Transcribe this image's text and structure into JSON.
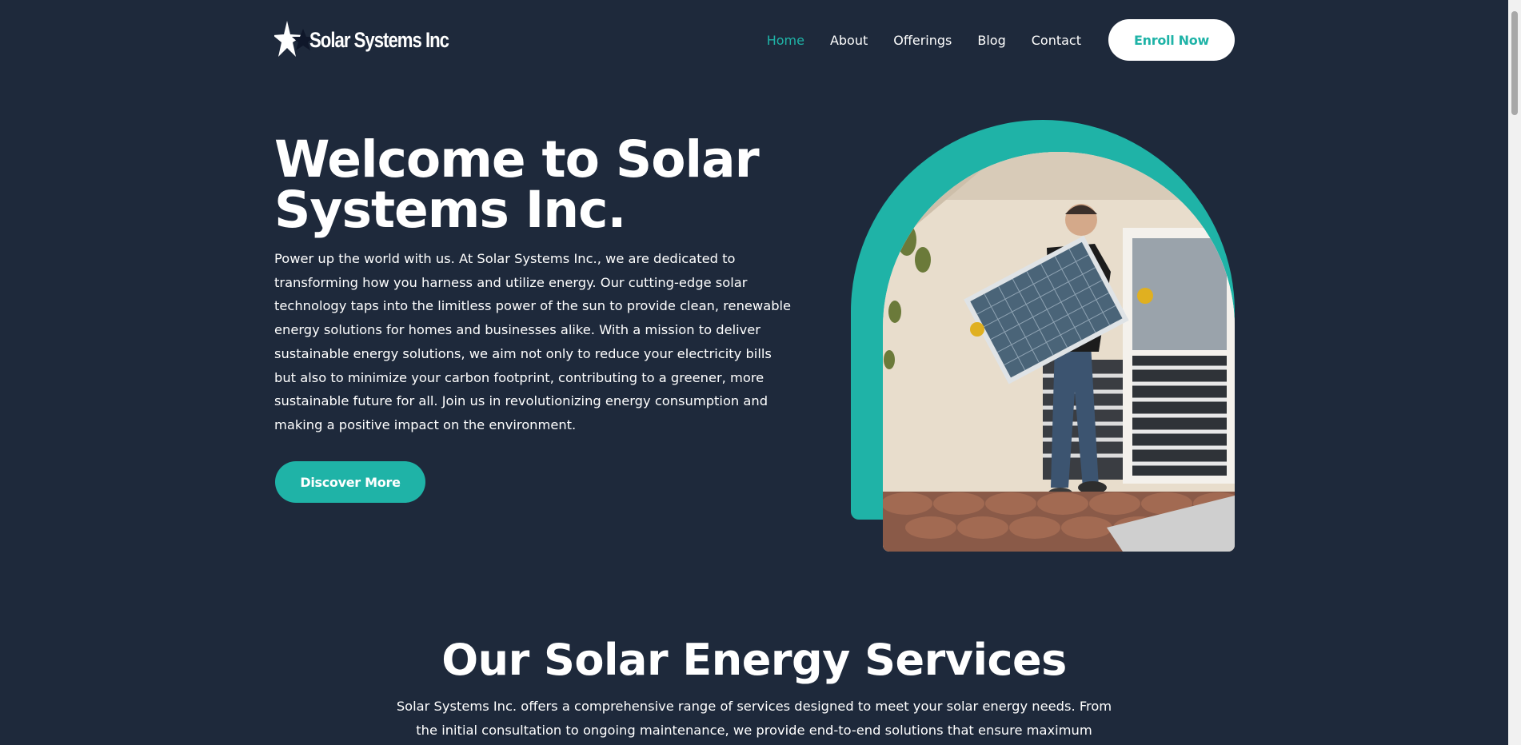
{
  "header": {
    "logo_text": "Solar Systems Inc",
    "logo_icon": "star-icon",
    "nav": [
      {
        "label": "Home",
        "active": true
      },
      {
        "label": "About",
        "active": false
      },
      {
        "label": "Offerings",
        "active": false
      },
      {
        "label": "Blog",
        "active": false
      },
      {
        "label": "Contact",
        "active": false
      }
    ],
    "cta_label": "Enroll Now"
  },
  "hero": {
    "title": "Welcome to Solar Systems Inc.",
    "text": "Power up the world with us. At Solar Systems Inc., we are dedicated to transforming how you harness and utilize energy. Our cutting-edge solar technology taps into the limitless power of the sun to provide clean, renewable energy solutions for homes and businesses alike. With a mission to deliver sustainable energy solutions, we aim not only to reduce your electricity bills but also to minimize your carbon footprint, contributing to a greener, more sustainable future for all. Join us in revolutionizing energy consumption and making a positive impact on the environment.",
    "button_label": "Discover More"
  },
  "services": {
    "title": "Our Solar Energy Services",
    "text": "Solar Systems Inc. offers a comprehensive range of services designed to meet your solar energy needs. From the initial consultation to ongoing maintenance, we provide end-to-end solutions that ensure maximum efficiency and"
  },
  "colors": {
    "background": "#1e293b",
    "accent": "#1fb3a7",
    "text": "#ffffff"
  }
}
